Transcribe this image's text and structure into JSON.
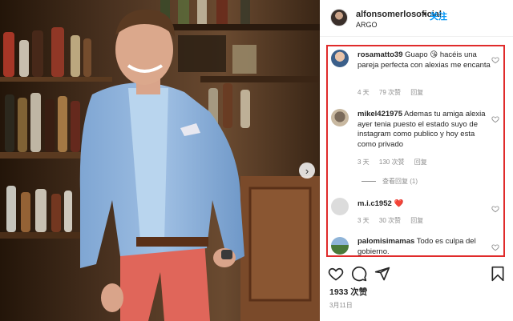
{
  "post": {
    "username": "alfonsomerlosoficial",
    "separator": "•",
    "follow_label": "关注",
    "location": "ARGO",
    "likes": "1933 次赞",
    "date": "3月11日"
  },
  "comments": [
    {
      "user": "rosamatto39",
      "text": "Guapo 😘 hacéis una pareja perfecta con alexias me encanta",
      "age": "4 天",
      "likes": "79 次赞",
      "reply": "回复"
    },
    {
      "user": "mikel421975",
      "text": "Ademas tu amiga alexia ayer tenia puesto el estado suyo de instagram como publico y hoy esta como privado",
      "age": "3 天",
      "likes": "130 次赞",
      "reply": "回复",
      "view_replies": "查看回复 (1)"
    },
    {
      "user": "m.i.c1952",
      "text": "❤️",
      "age": "3 天",
      "likes": "30 次赞",
      "reply": "回复"
    },
    {
      "user": "palomisimamas",
      "text": "Todo es culpa del gobierno.",
      "age": "",
      "likes": "",
      "reply": ""
    }
  ],
  "icons": {
    "next": "chevron-right-icon",
    "like": "heart-icon",
    "comment": "comment-icon",
    "share": "paper-plane-icon",
    "save": "bookmark-icon"
  },
  "colors": {
    "follow": "#0095f6",
    "highlight_box": "#e02b2b",
    "muted_text": "#8e8e8e"
  }
}
